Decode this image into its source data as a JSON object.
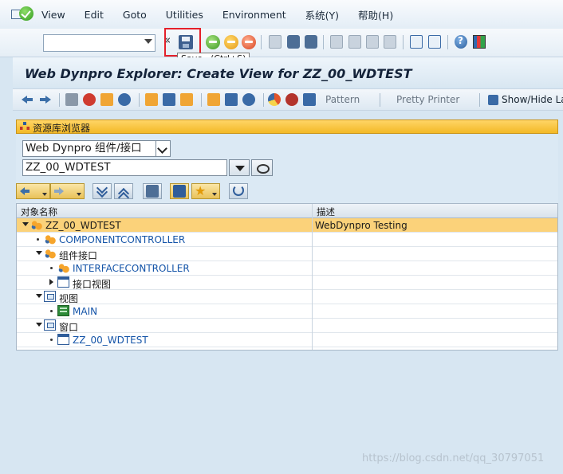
{
  "menubar": {
    "items": [
      "View",
      "Edit",
      "Goto",
      "Utilities",
      "Environment",
      "系统(Y)",
      "帮助(H)"
    ]
  },
  "system_toolbar": {
    "command_field": "",
    "chevron": "«",
    "tooltip": {
      "label": "Save",
      "shortcut": "(Ctrl+S)"
    }
  },
  "title": "Web Dynpro Explorer: Create View for ZZ_00_WDTEST",
  "app_toolbar": {
    "pattern_label": "Pattern",
    "pretty_printer_label": "Pretty Printer",
    "show_hide_label": "Show/Hide La"
  },
  "repository": {
    "header_label": "资源库浏览器",
    "object_type": "Web Dynpro 组件/接口",
    "object_name": "ZZ_00_WDTEST"
  },
  "tree": {
    "columns": [
      "对象名称",
      "描述"
    ],
    "rows": [
      {
        "name": "ZZ_00_WDTEST",
        "desc": "WebDynpro Testing",
        "level": 0,
        "toggle": "open",
        "icon": "component-icon",
        "link": false,
        "selected": true
      },
      {
        "name": "COMPONENTCONTROLLER",
        "desc": "",
        "level": 1,
        "toggle": "dot",
        "icon": "component-icon",
        "link": true,
        "selected": false
      },
      {
        "name": "组件接口",
        "desc": "",
        "level": 1,
        "toggle": "open",
        "icon": "component-icon",
        "link": false,
        "selected": false
      },
      {
        "name": "INTERFACECONTROLLER",
        "desc": "",
        "level": 2,
        "toggle": "dot",
        "icon": "component-icon",
        "link": true,
        "selected": false
      },
      {
        "name": "接口视图",
        "desc": "",
        "level": 2,
        "toggle": "closed",
        "icon": "window-icon",
        "link": false,
        "selected": false
      },
      {
        "name": "视图",
        "desc": "",
        "level": 1,
        "toggle": "open",
        "icon": "views-folder-icon",
        "link": false,
        "selected": false
      },
      {
        "name": "MAIN",
        "desc": "",
        "level": 2,
        "toggle": "dot",
        "icon": "view-icon",
        "link": true,
        "selected": false
      },
      {
        "name": "窗口",
        "desc": "",
        "level": 1,
        "toggle": "open",
        "icon": "views-folder-icon",
        "link": false,
        "selected": false
      },
      {
        "name": "ZZ_00_WDTEST",
        "desc": "",
        "level": 2,
        "toggle": "dot",
        "icon": "window-icon",
        "link": true,
        "selected": false
      }
    ]
  },
  "watermark": "https://blog.csdn.net/qq_30797051"
}
